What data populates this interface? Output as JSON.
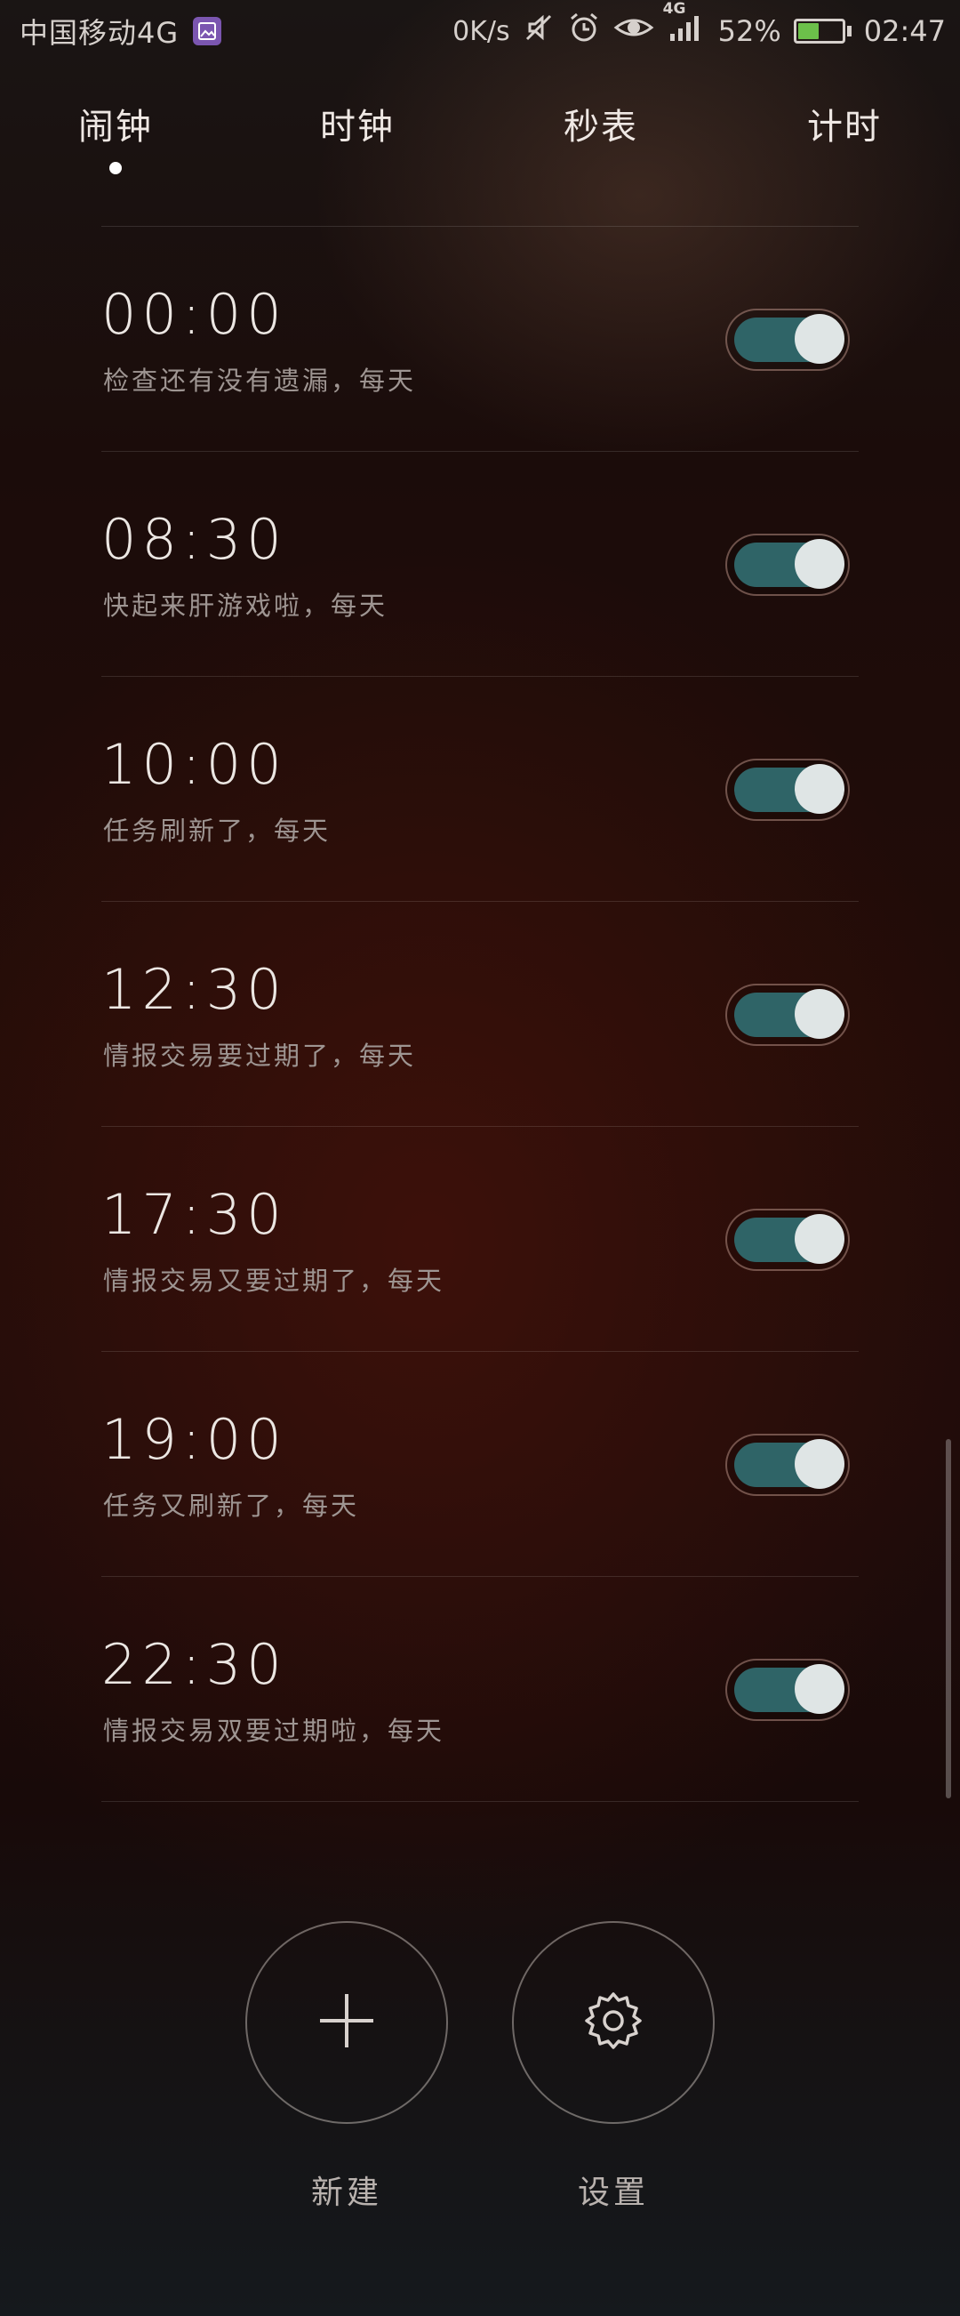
{
  "status_bar": {
    "carrier": "中国移动4G",
    "speed": "0K/s",
    "network": "4G",
    "battery_percent": "52%",
    "battery_level": 0.52,
    "time": "02:47",
    "icons": [
      "gallery-app-icon",
      "mute-icon",
      "alarm-clock-icon",
      "eye-icon",
      "signal-icon",
      "battery-icon"
    ]
  },
  "tabs": [
    {
      "label": "闹钟",
      "active": true
    },
    {
      "label": "时钟",
      "active": false
    },
    {
      "label": "秒表",
      "active": false
    },
    {
      "label": "计时",
      "active": false
    }
  ],
  "alarms": [
    {
      "time": "00:00",
      "label": "检查还有没有遗漏，每天",
      "enabled": true
    },
    {
      "time": "08:30",
      "label": "快起来肝游戏啦，每天",
      "enabled": true
    },
    {
      "time": "10:00",
      "label": "任务刷新了，每天",
      "enabled": true
    },
    {
      "time": "12:30",
      "label": "情报交易要过期了，每天",
      "enabled": true
    },
    {
      "time": "17:30",
      "label": "情报交易又要过期了，每天",
      "enabled": true
    },
    {
      "time": "19:00",
      "label": "任务又刷新了，每天",
      "enabled": true
    },
    {
      "time": "22:30",
      "label": "情报交易双要过期啦，每天",
      "enabled": true
    }
  ],
  "actions": {
    "new": {
      "label": "新建",
      "icon": "plus-icon"
    },
    "settings": {
      "label": "设置",
      "icon": "gear-icon"
    }
  },
  "colors": {
    "toggle_on": "#2f6467",
    "toggle_knob": "#dfe5e5",
    "battery_fill": "#6cc04a",
    "app_badge": "#7b56b0"
  }
}
